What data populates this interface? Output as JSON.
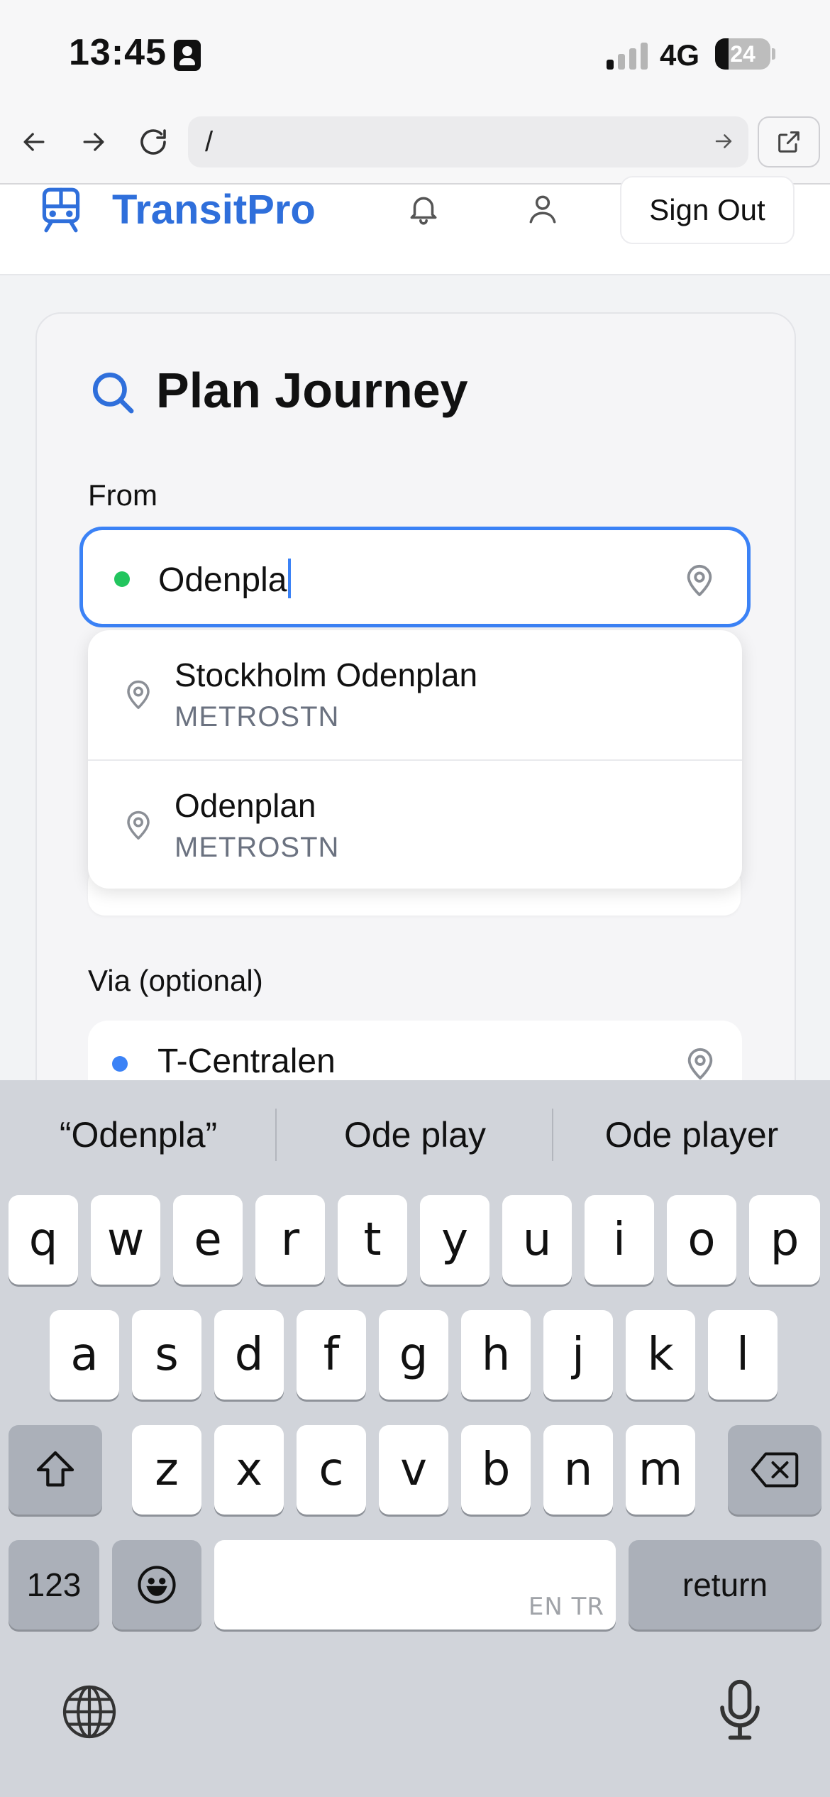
{
  "status_bar": {
    "time": "13:45",
    "network": "4G",
    "battery": "24",
    "battery_level": 0.24,
    "icons": [
      "id-card-icon",
      "signal-icon",
      "battery-icon"
    ]
  },
  "browser": {
    "url": "/",
    "icons": [
      "back-arrow-icon",
      "forward-arrow-icon",
      "reload-icon",
      "go-arrow-icon",
      "open-external-icon"
    ]
  },
  "header": {
    "brand": "TransitPro",
    "sign_out": "Sign Out",
    "icons": [
      "train-icon",
      "bell-icon",
      "user-icon"
    ]
  },
  "journey": {
    "title": "Plan Journey",
    "from_label": "From",
    "from_value": "Odenpla",
    "via_label": "Via (optional)",
    "via_value": "T-Centralen",
    "suggestions": [
      {
        "name": "Stockholm Odenplan",
        "type": "METROSTN"
      },
      {
        "name": "Odenplan",
        "type": "METROSTN"
      }
    ]
  },
  "keyboard": {
    "predictions": [
      "“Odenpla”",
      "Ode play",
      "Ode player"
    ],
    "row1": [
      "q",
      "w",
      "e",
      "r",
      "t",
      "y",
      "u",
      "i",
      "o",
      "p"
    ],
    "row2": [
      "a",
      "s",
      "d",
      "f",
      "g",
      "h",
      "j",
      "k",
      "l"
    ],
    "row3": [
      "z",
      "x",
      "c",
      "v",
      "b",
      "n",
      "m"
    ],
    "numbers_key": "123",
    "return_key": "return",
    "space_hint": "EN TR",
    "icons": [
      "shift-icon",
      "backspace-icon",
      "emoji-icon",
      "globe-icon",
      "microphone-icon"
    ]
  },
  "colors": {
    "accent": "#3b82f6",
    "brand": "#2f6fdb",
    "from_dot": "#22c55e",
    "via_dot": "#3b82f6"
  }
}
